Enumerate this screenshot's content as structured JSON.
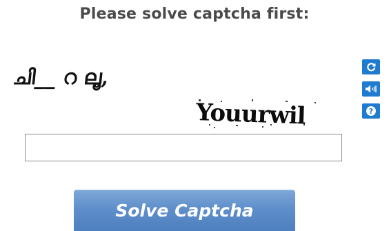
{
  "heading": "Please solve captcha first:",
  "captcha": {
    "line1_text": "ചി__ റ ലൂ,",
    "line2_text": "Youurwil"
  },
  "tools": {
    "refresh_icon": "refresh-icon",
    "audio_icon": "audio-icon",
    "help_icon": "help-icon",
    "button_color": "#1e7bd0"
  },
  "answer": {
    "value": "",
    "placeholder": ""
  },
  "submit": {
    "label": "Solve Captcha",
    "color": "#5f8fcb"
  }
}
